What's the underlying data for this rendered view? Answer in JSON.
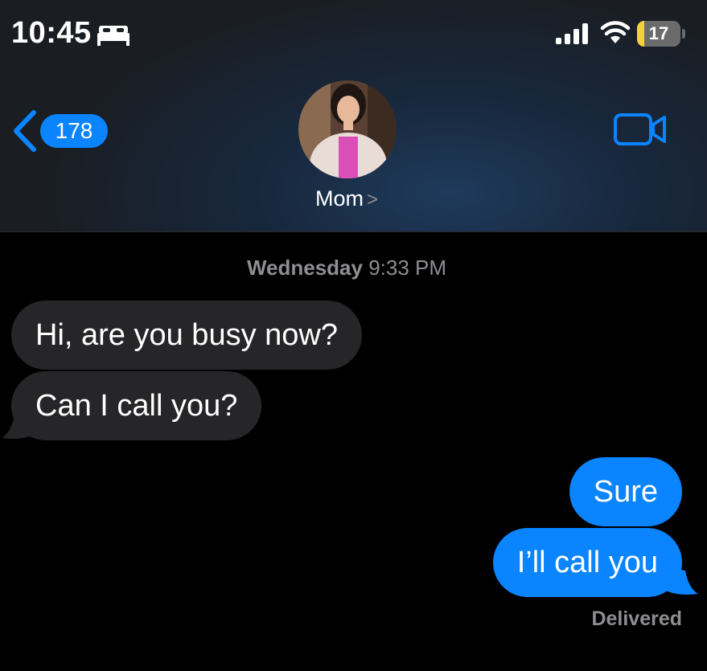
{
  "status_bar": {
    "time": "10:45",
    "focus_icon": "bed-icon",
    "signal_icon": "cellular-signal-icon",
    "wifi_icon": "wifi-icon",
    "battery_level": "17",
    "battery_color": "#f4d13a"
  },
  "nav": {
    "back_icon": "chevron-left-icon",
    "back_count": "178",
    "contact_name": "Mom",
    "contact_chevron": ">",
    "video_icon": "video-camera-icon"
  },
  "conversation": {
    "timestamp_day": "Wednesday",
    "timestamp_time": "9:33 PM",
    "messages": [
      {
        "direction": "incoming",
        "text": "Hi, are you busy now?"
      },
      {
        "direction": "incoming",
        "text": "Can I call you?"
      },
      {
        "direction": "outgoing",
        "text": "Sure"
      },
      {
        "direction": "outgoing",
        "text": "I’ll call you"
      }
    ],
    "delivery_status": "Delivered"
  },
  "colors": {
    "accent": "#0a84ff",
    "incoming_bubble": "#262628",
    "secondary_text": "#8e8e93"
  }
}
